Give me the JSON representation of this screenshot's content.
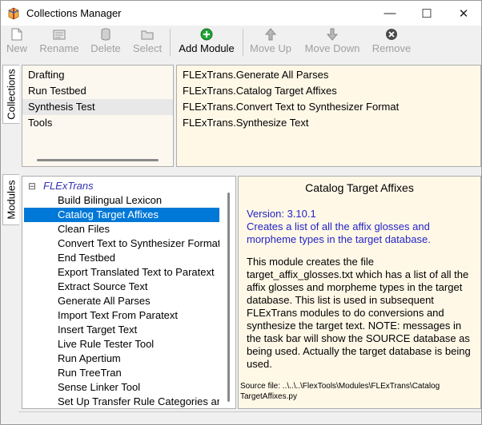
{
  "window": {
    "title": "Collections Manager"
  },
  "window_controls": {
    "minimize": "—",
    "maximize": "☐",
    "close": "✕"
  },
  "toolbar": {
    "new": "New",
    "rename": "Rename",
    "delete": "Delete",
    "select": "Select",
    "add_module": "Add Module",
    "move_up": "Move Up",
    "move_down": "Move Down",
    "remove": "Remove"
  },
  "tabs": {
    "collections": "Collections",
    "modules": "Modules"
  },
  "collections": {
    "items": [
      "Drafting",
      "Run Testbed",
      "Synthesis Test",
      "Tools"
    ],
    "selected_index": 2
  },
  "collection_modules": [
    "FLExTrans.Generate All Parses",
    "FLExTrans.Catalog Target Affixes",
    "FLExTrans.Convert Text to Synthesizer Format",
    "FLExTrans.Synthesize Text"
  ],
  "modules_tree": {
    "group_toggle": "⊟",
    "group": "FLExTrans",
    "items": [
      "Build Bilingual Lexicon",
      "Catalog Target Affixes",
      "Clean Files",
      "Convert Text to Synthesizer Format",
      "End Testbed",
      "Export Translated Text to Paratext",
      "Extract Source Text",
      "Generate All Parses",
      "Import Text From Paratext",
      "Insert Target Text",
      "Live Rule Tester Tool",
      "Run Apertium",
      "Run TreeTran",
      "Sense Linker Tool",
      "Set Up Transfer Rule Categories and Attributes"
    ],
    "selected_index": 1
  },
  "module_info": {
    "title": "Catalog Target Affixes",
    "version": "Version: 3.10.1",
    "summary": "Creates a list of all the affix glosses and morpheme types in the target database.",
    "description": "This module creates the file target_affix_glosses.txt which has a list of all the affix glosses and morpheme types in the target database. This list is used in subsequent FLExTrans modules to do conversions and synthesize the target text. NOTE: messages in the task bar will show the SOURCE database as being used. Actually the target database is being used.",
    "source_label": "Source file: ..\\..\\..\\FlexTools\\Modules\\FLExTrans\\CatalogTargetAffixes.py"
  },
  "colors": {
    "selection": "#0078d7",
    "light_selection": "#e8e8e8",
    "info_bg": "#fff8e7",
    "version_blue": "#2323c8",
    "group_blue": "#3232b4",
    "add_green": "#21a336"
  }
}
